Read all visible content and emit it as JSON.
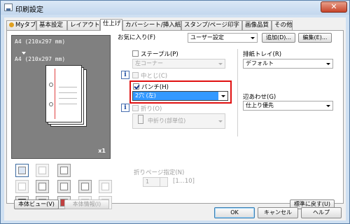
{
  "window": {
    "title": "印刷設定",
    "close_glyph": "✕"
  },
  "tabs": [
    "Myタブ",
    "基本設定",
    "レイアウト",
    "仕上げ",
    "カバーシート/挿入紙",
    "スタンプ/ページ印字",
    "画像品質",
    "その他"
  ],
  "preview": {
    "line1": "A4 (210x297 mm)",
    "line2": "A4 (210x297 mm)",
    "copies": "x1"
  },
  "favorites": {
    "label": "お気に入り(F)",
    "value": "ユーザー設定",
    "add": "追加(D)...",
    "edit": "編集(E)..."
  },
  "staple": {
    "label": "ステープル(P)",
    "value": "左コーナー",
    "checked": false
  },
  "center_staple": {
    "label": "中とじ(C)",
    "checked": false
  },
  "punch": {
    "label": "パンチ(H)",
    "value": "2穴 (左)",
    "checked": true
  },
  "fold": {
    "label": "折り(O)",
    "value": "中折り(部単位)",
    "checked": false
  },
  "fold_page": {
    "label": "折りページ指定(N)",
    "value": "1",
    "range": "[1...10]"
  },
  "output_tray": {
    "label": "排紙トレイ(R)",
    "value": "デフォルト"
  },
  "alignment": {
    "label": "辺あわせ(G)",
    "value": "仕上り優先"
  },
  "left_buttons": {
    "printer_view": "本体ビュー(V)",
    "printer_info": "本体情報(I)"
  },
  "restore": "標準に戻す(U)",
  "dialog_buttons": {
    "ok": "OK",
    "cancel": "キャンセル",
    "help": "ヘルプ"
  },
  "info_glyph": "i",
  "colors": {
    "highlight_box": "#e01010",
    "selection": "#3399ff"
  }
}
